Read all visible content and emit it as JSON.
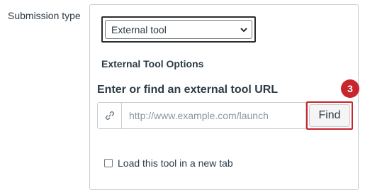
{
  "submission": {
    "label": "Submission type",
    "selected_type": "External tool"
  },
  "external_tool": {
    "options_title": "External Tool Options",
    "url_title": "Enter or find an external tool URL",
    "url_value": "",
    "url_placeholder": "http://www.example.com/launch",
    "find_label": "Find",
    "step_badge": "3",
    "new_tab_label": "Load this tool in a new tab",
    "new_tab_checked": false
  },
  "icons": {
    "select_chevron": "chevron-down-icon",
    "url_addon": "link-icon"
  },
  "colors": {
    "highlight": "#c8252c",
    "text": "#2d3b45",
    "border": "#c7cdd1"
  }
}
